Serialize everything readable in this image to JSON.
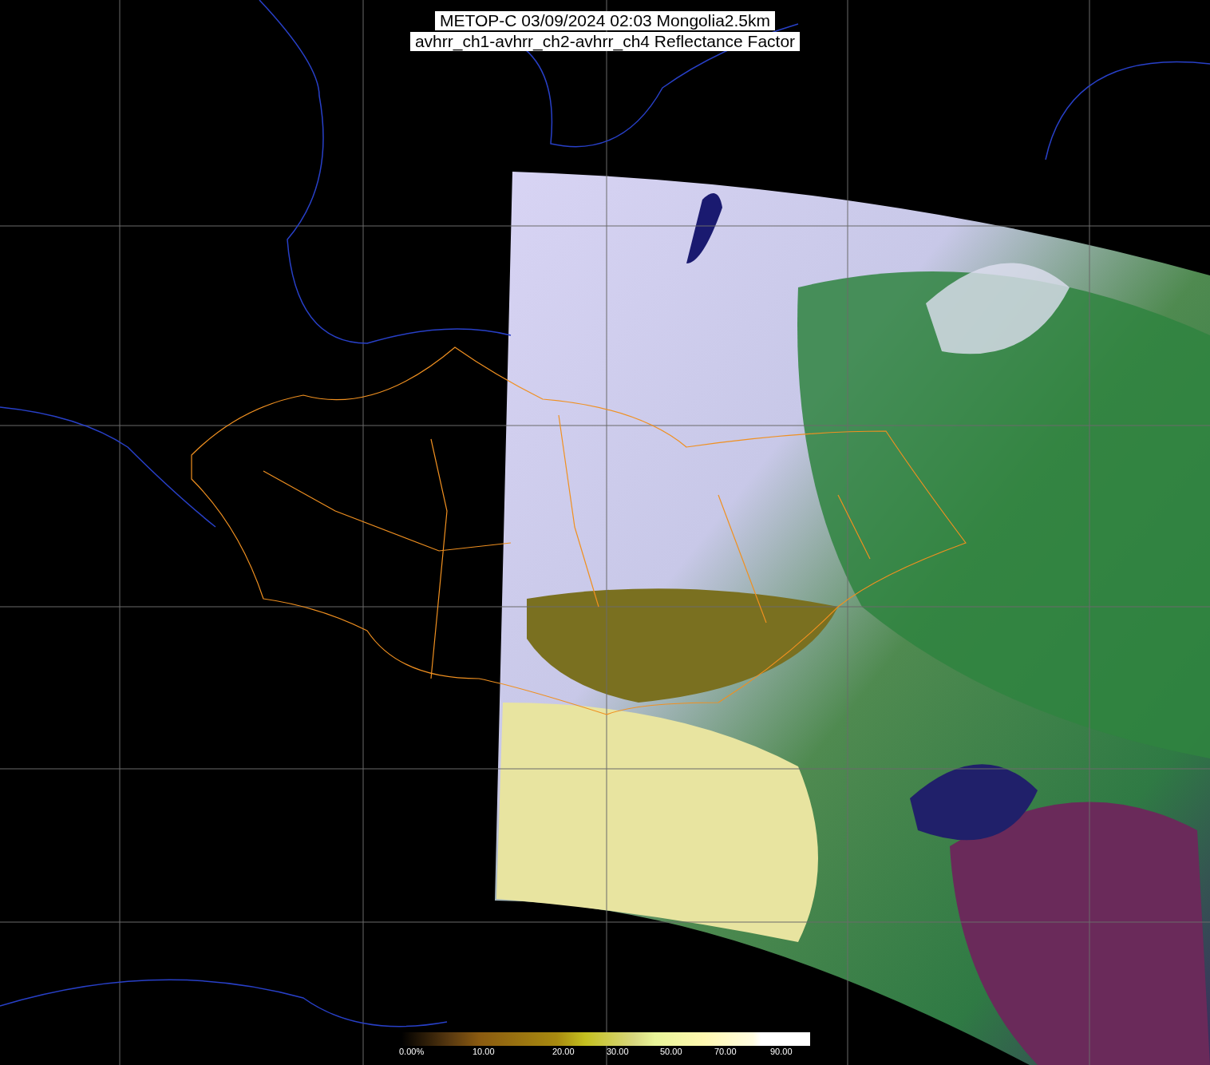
{
  "title": {
    "lines": [
      "METOP-C 03/09/2024 02:03 Mongolia2.5km",
      "avhrr_ch1-avhrr_ch2-avhrr_ch4 Reflectance Factor"
    ]
  },
  "color_scale": {
    "labels": [
      "0.00%",
      "10.00",
      "20.00",
      "30.00",
      "50.00",
      "70.00",
      "90.00"
    ]
  }
}
